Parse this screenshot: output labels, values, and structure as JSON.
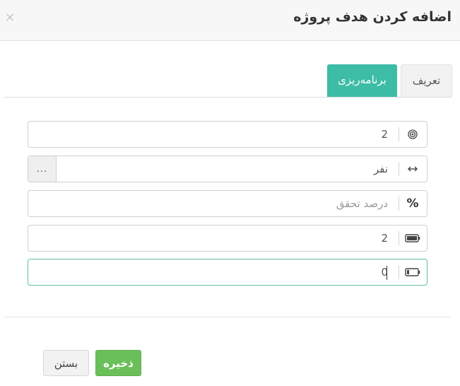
{
  "modal": {
    "title": "اضافه کردن هدف پروژه",
    "close_symbol": "×"
  },
  "tabs": [
    {
      "label": "تعریف",
      "active": false
    },
    {
      "label": "برنامه‌ریزی",
      "active": true
    }
  ],
  "fields": {
    "target": {
      "icon": "target-icon",
      "value": "2",
      "placeholder": ""
    },
    "unit": {
      "icon": "horizontal-arrows-icon",
      "value": "نفر",
      "button_label": "..."
    },
    "achievement_percent": {
      "icon_text": "%",
      "value": "",
      "placeholder": "درصد تحقق"
    },
    "full_battery": {
      "icon": "battery-full-icon",
      "value": "2"
    },
    "low_battery": {
      "icon": "battery-low-icon",
      "value": "0"
    }
  },
  "footer": {
    "save_label": "ذخیره",
    "close_label": "بستن"
  },
  "colors": {
    "accent": "#3dbca6",
    "save": "#6bbf5a",
    "focus_border": "#5fbfa6"
  }
}
